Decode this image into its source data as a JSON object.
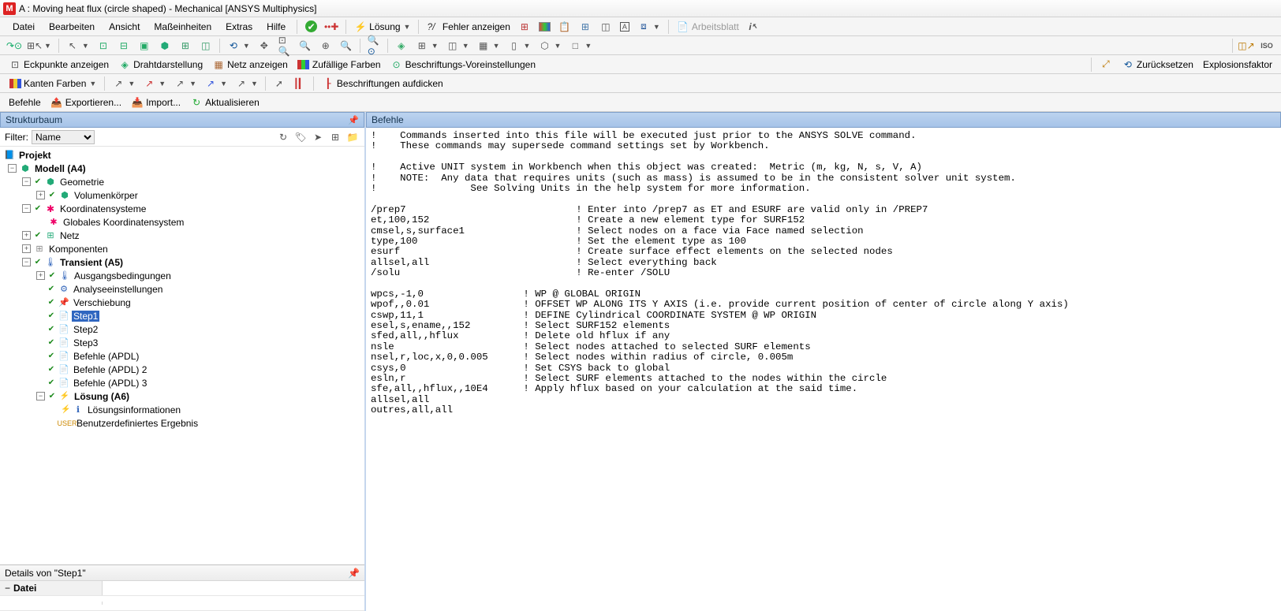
{
  "titlebar": {
    "logo": "M",
    "title": "A : Moving heat flux (circle shaped) - Mechanical [ANSYS Multiphysics]"
  },
  "menu": {
    "items": [
      "Datei",
      "Bearbeiten",
      "Ansicht",
      "Maßeinheiten",
      "Extras",
      "Hilfe"
    ],
    "losung": "Lösung",
    "fehler": "Fehler anzeigen",
    "arbeitsblatt": "Arbeitsblatt"
  },
  "tb2": {
    "eckpunkte": "Eckpunkte anzeigen",
    "draht": "Drahtdarstellung",
    "netz": "Netz anzeigen",
    "zufallig": "Zufällige Farben",
    "beschr": "Beschriftungs-Voreinstellungen",
    "zuruck": "Zurücksetzen",
    "explo": "Explosionsfaktor"
  },
  "tb3": {
    "kanten": "Kanten Farben",
    "beschr2": "Beschriftungen aufdicken"
  },
  "tb4": {
    "befehle": "Befehle",
    "export": "Exportieren...",
    "import": "Import...",
    "aktual": "Aktualisieren"
  },
  "left": {
    "header": "Strukturbaum",
    "filter": "Filter:",
    "name": "Name",
    "tree": {
      "projekt": "Projekt",
      "modell": "Modell (A4)",
      "geometrie": "Geometrie",
      "volumen": "Volumenkörper",
      "koord": "Koordinatensysteme",
      "globkoord": "Globales Koordinatensystem",
      "netz": "Netz",
      "komp": "Komponenten",
      "transient": "Transient (A5)",
      "ausgang": "Ausgangsbedingungen",
      "analyse": "Analyseeinstellungen",
      "verschiebung": "Verschiebung",
      "step1": "Step1",
      "step2": "Step2",
      "step3": "Step3",
      "befapdl": "Befehle (APDL)",
      "befapdl2": "Befehle (APDL) 2",
      "befapdl3": "Befehle (APDL) 3",
      "losung": "Lösung (A6)",
      "losinfo": "Lösungsinformationen",
      "benutz": "Benutzerdefiniertes Ergebnis"
    },
    "details_hdr": "Details von \"Step1\"",
    "details_cat": "Datei"
  },
  "right": {
    "header": "Befehle",
    "code": "!    Commands inserted into this file will be executed just prior to the ANSYS SOLVE command.\n!    These commands may supersede command settings set by Workbench.\n\n!    Active UNIT system in Workbench when this object was created:  Metric (m, kg, N, s, V, A)\n!    NOTE:  Any data that requires units (such as mass) is assumed to be in the consistent solver unit system.\n!                See Solving Units in the help system for more information.\n\n/prep7                             ! Enter into /prep7 as ET and ESURF are valid only in /PREP7\net,100,152                         ! Create a new element type for SURF152\ncmsel,s,surface1                   ! Select nodes on a face via Face named selection\ntype,100                           ! Set the element type as 100\nesurf                              ! Create surface effect elements on the selected nodes\nallsel,all                         ! Select everything back\n/solu                              ! Re-enter /SOLU\n\nwpcs,-1,0                 ! WP @ GLOBAL ORIGIN\nwpof,,0.01                ! OFFSET WP ALONG ITS Y AXIS (i.e. provide current position of center of circle along Y axis)\ncswp,11,1                 ! DEFINE Cylindrical COORDINATE SYSTEM @ WP ORIGIN\nesel,s,ename,,152         ! Select SURF152 elements\nsfed,all,,hflux           ! Delete old hflux if any\nnsle                      ! Select nodes attached to selected SURF elements\nnsel,r,loc,x,0,0.005      ! Select nodes within radius of circle, 0.005m\ncsys,0                    ! Set CSYS back to global\nesln,r                    ! Select SURF elements attached to the nodes within the circle\nsfe,all,,hflux,,10E4      ! Apply hflux based on your calculation at the said time.\nallsel,all\noutres,all,all"
  }
}
